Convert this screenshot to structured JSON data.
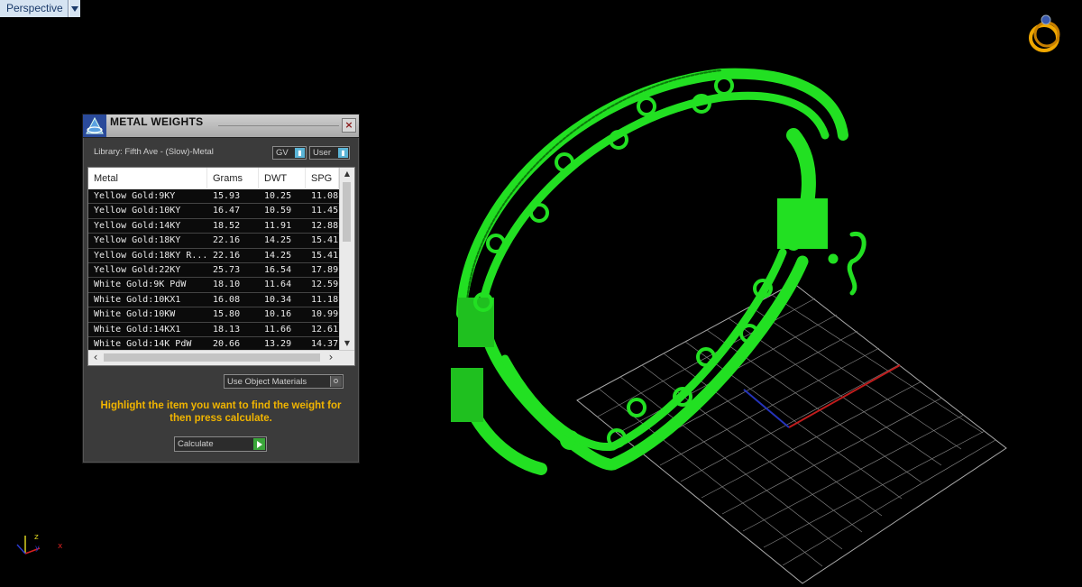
{
  "viewport": {
    "label": "Perspective"
  },
  "dialog": {
    "title": "METAL WEIGHTS",
    "close": "×",
    "library_label": "Library: Fifth Ave - (Slow)-Metal",
    "gv_combo": "GV",
    "user_combo": "User",
    "columns": [
      "Metal",
      "Grams",
      "DWT",
      "SPG"
    ],
    "rows": [
      [
        "Yellow Gold:9KY",
        "15.93",
        "10.25",
        "11.08"
      ],
      [
        "Yellow Gold:10KY",
        "16.47",
        "10.59",
        "11.45"
      ],
      [
        "Yellow Gold:14KY",
        "18.52",
        "11.91",
        "12.88"
      ],
      [
        "Yellow Gold:18KY",
        "22.16",
        "14.25",
        "15.41"
      ],
      [
        "Yellow Gold:18KY R...",
        "22.16",
        "14.25",
        "15.41"
      ],
      [
        "Yellow Gold:22KY",
        "25.73",
        "16.54",
        "17.89"
      ],
      [
        "White Gold:9K PdW",
        "18.10",
        "11.64",
        "12.59"
      ],
      [
        "White Gold:10KX1",
        "16.08",
        "10.34",
        "11.18"
      ],
      [
        "White Gold:10KW",
        "15.80",
        "10.16",
        "10.99"
      ],
      [
        "White Gold:14KX1",
        "18.13",
        "11.66",
        "12.61"
      ],
      [
        "White Gold:14K PdW",
        "20.66",
        "13.29",
        "14.37"
      ]
    ],
    "use_object_materials": "Use Object Materials",
    "hint": "Highlight the item you want to find the weight for then press calculate.",
    "calculate": "Calculate"
  },
  "colors": {
    "model": "#22e022",
    "hint": "#f0b400",
    "x_axis": "#d42020",
    "y_axis": "#2a3ad0",
    "z_axis": "#d8d020"
  },
  "icons": [
    "chevron-down-icon",
    "app-logo-icon",
    "close-icon",
    "ring-icon",
    "axis-triad-icon"
  ],
  "axis_labels": {
    "x": "x",
    "y": "y",
    "z": "z"
  }
}
